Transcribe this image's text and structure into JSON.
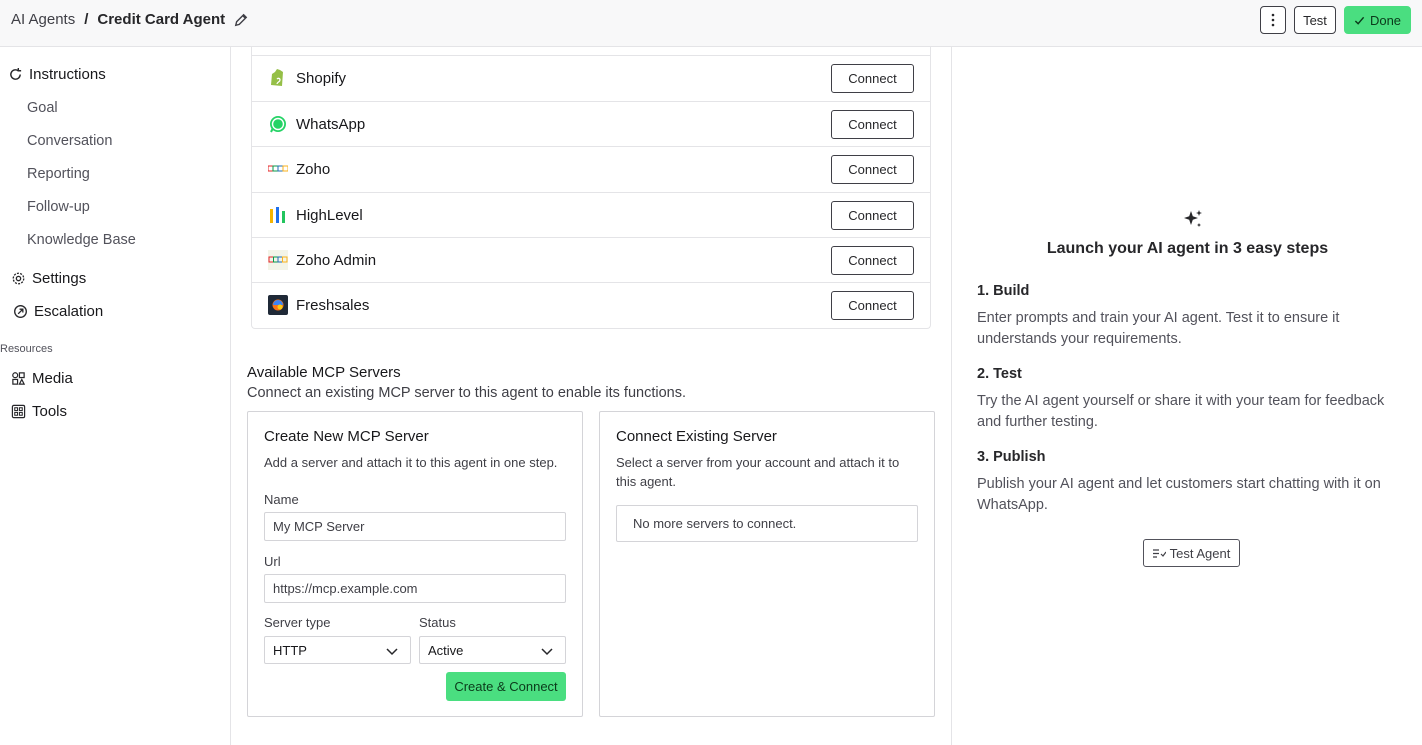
{
  "header": {
    "breadcrumb_root": "AI Agents",
    "breadcrumb_sep": "/",
    "breadcrumb_current": "Credit Card Agent",
    "more_icon": "more-vertical-icon",
    "test_label": "Test",
    "done_label": "Done"
  },
  "sidebar": {
    "instructions": "Instructions",
    "sub_items": [
      "Goal",
      "Conversation",
      "Reporting",
      "Follow-up",
      "Knowledge Base"
    ],
    "settings": "Settings",
    "escalation": "Escalation",
    "resources_header": "Resources",
    "media": "Media",
    "tools": "Tools"
  },
  "integrations": [
    {
      "name": "Shopify",
      "action": "Connect",
      "icon": "shopify-icon",
      "color": "#95bf47"
    },
    {
      "name": "WhatsApp",
      "action": "Connect",
      "icon": "whatsapp-icon",
      "color": "#25d366"
    },
    {
      "name": "Zoho",
      "action": "Connect",
      "icon": "zoho-icon",
      "color": "#e42527"
    },
    {
      "name": "HighLevel",
      "action": "Connect",
      "icon": "highlevel-icon",
      "color": "#f5b400"
    },
    {
      "name": "Zoho Admin",
      "action": "Connect",
      "icon": "zoho-admin-icon",
      "color": "#e42527"
    },
    {
      "name": "Freshsales",
      "action": "Connect",
      "icon": "freshsales-icon",
      "color": "#1f2937"
    }
  ],
  "mcp": {
    "title": "Available MCP Servers",
    "subtitle": "Connect an existing MCP server to this agent to enable its functions.",
    "create": {
      "title": "Create New MCP Server",
      "desc": "Add a server and attach it to this agent in one step.",
      "name_label": "Name",
      "name_value": "My MCP Server",
      "url_label": "Url",
      "url_value": "https://mcp.example.com",
      "server_type_label": "Server type",
      "server_type_value": "HTTP",
      "status_label": "Status",
      "status_value": "Active",
      "submit_label": "Create & Connect"
    },
    "existing": {
      "title": "Connect Existing Server",
      "desc": "Select a server from your account and attach it to this agent.",
      "empty": "No more servers to connect."
    }
  },
  "right_panel": {
    "title": "Launch your AI agent in 3 easy steps",
    "steps": [
      {
        "title": "1. Build",
        "desc": "Enter prompts and train your AI agent. Test it to ensure it understands your requirements."
      },
      {
        "title": "2. Test",
        "desc": "Try the AI agent yourself or share it with your team for feedback and further testing."
      },
      {
        "title": "3. Publish",
        "desc": "Publish your AI agent and let customers start chatting with it on WhatsApp."
      }
    ],
    "test_agent_label": "Test Agent"
  },
  "colors": {
    "accent": "#4ade80",
    "border": "#e4e4e7"
  }
}
